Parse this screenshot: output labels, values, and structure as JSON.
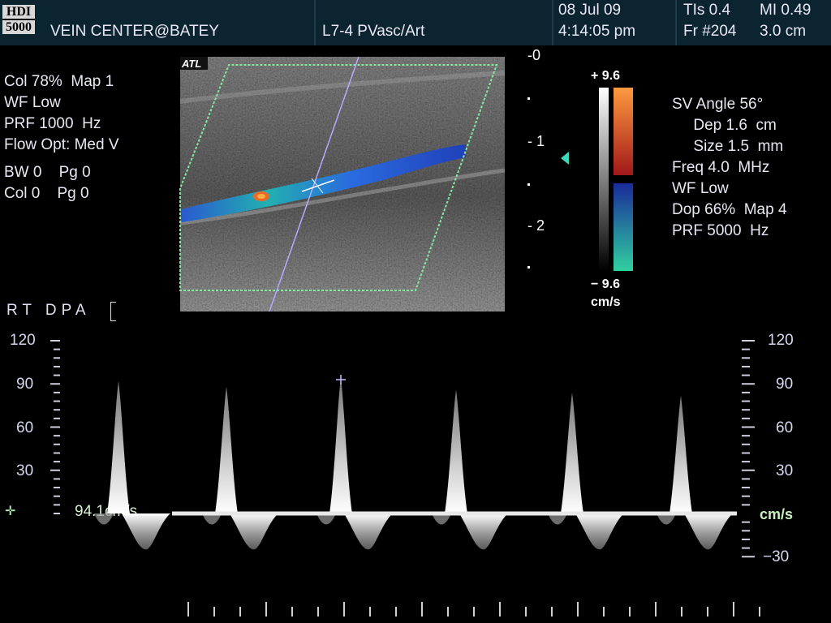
{
  "header": {
    "logo_line1": "HDI",
    "logo_line2": "5000",
    "facility": "VEIN CENTER@BATEY",
    "transducer": "L7-4 PVasc/Art",
    "date": "08 Jul 09",
    "time": "4:14:05 pm",
    "tis": "TIs 0.4",
    "mi": "MI 0.49",
    "frame": "Fr #204",
    "depth": "3.0 cm"
  },
  "left_params": [
    "Col 78%  Map 1",
    "WF Low",
    "PRF 1000  Hz",
    "Flow Opt: Med V",
    "BW 0    Pg 0",
    "Col 0    Pg 0"
  ],
  "right_params": [
    "SV Angle 56°",
    "     Dep 1.6  cm",
    "     Size 1.5  mm",
    "Freq 4.0  MHz",
    "WF Low",
    "Dop 66%  Map 4",
    "PRF 5000  Hz"
  ],
  "image": {
    "brand_tag": "ATL",
    "depth_scale": [
      "-0",
      "- 1",
      "- 2"
    ]
  },
  "colorbar": {
    "top": "+ 9.6",
    "bottom": "− 9.6",
    "unit": "cm/s",
    "colors": {
      "positive_top": "#ff9a40",
      "positive_bottom": "#a01818",
      "negative_top": "#1a2a9a",
      "negative_bottom": "#30d0a0"
    }
  },
  "vessel_label": "RT  DPA",
  "spectral": {
    "left_axis": [
      "120",
      "90",
      "60",
      "30"
    ],
    "right_axis": [
      "120",
      "90",
      "60",
      "30",
      "−30"
    ],
    "unit": "cm/s",
    "velocity_readout": "94.1cm/s"
  },
  "chart_data": {
    "type": "area",
    "ylim": [
      -30,
      120
    ],
    "ylabel": "cm/s",
    "peaks_cm_s": [
      92,
      88,
      94.1,
      86,
      84,
      82
    ],
    "reverse_cm_s": [
      -25,
      -25,
      -25,
      -25,
      -25,
      -25
    ]
  }
}
